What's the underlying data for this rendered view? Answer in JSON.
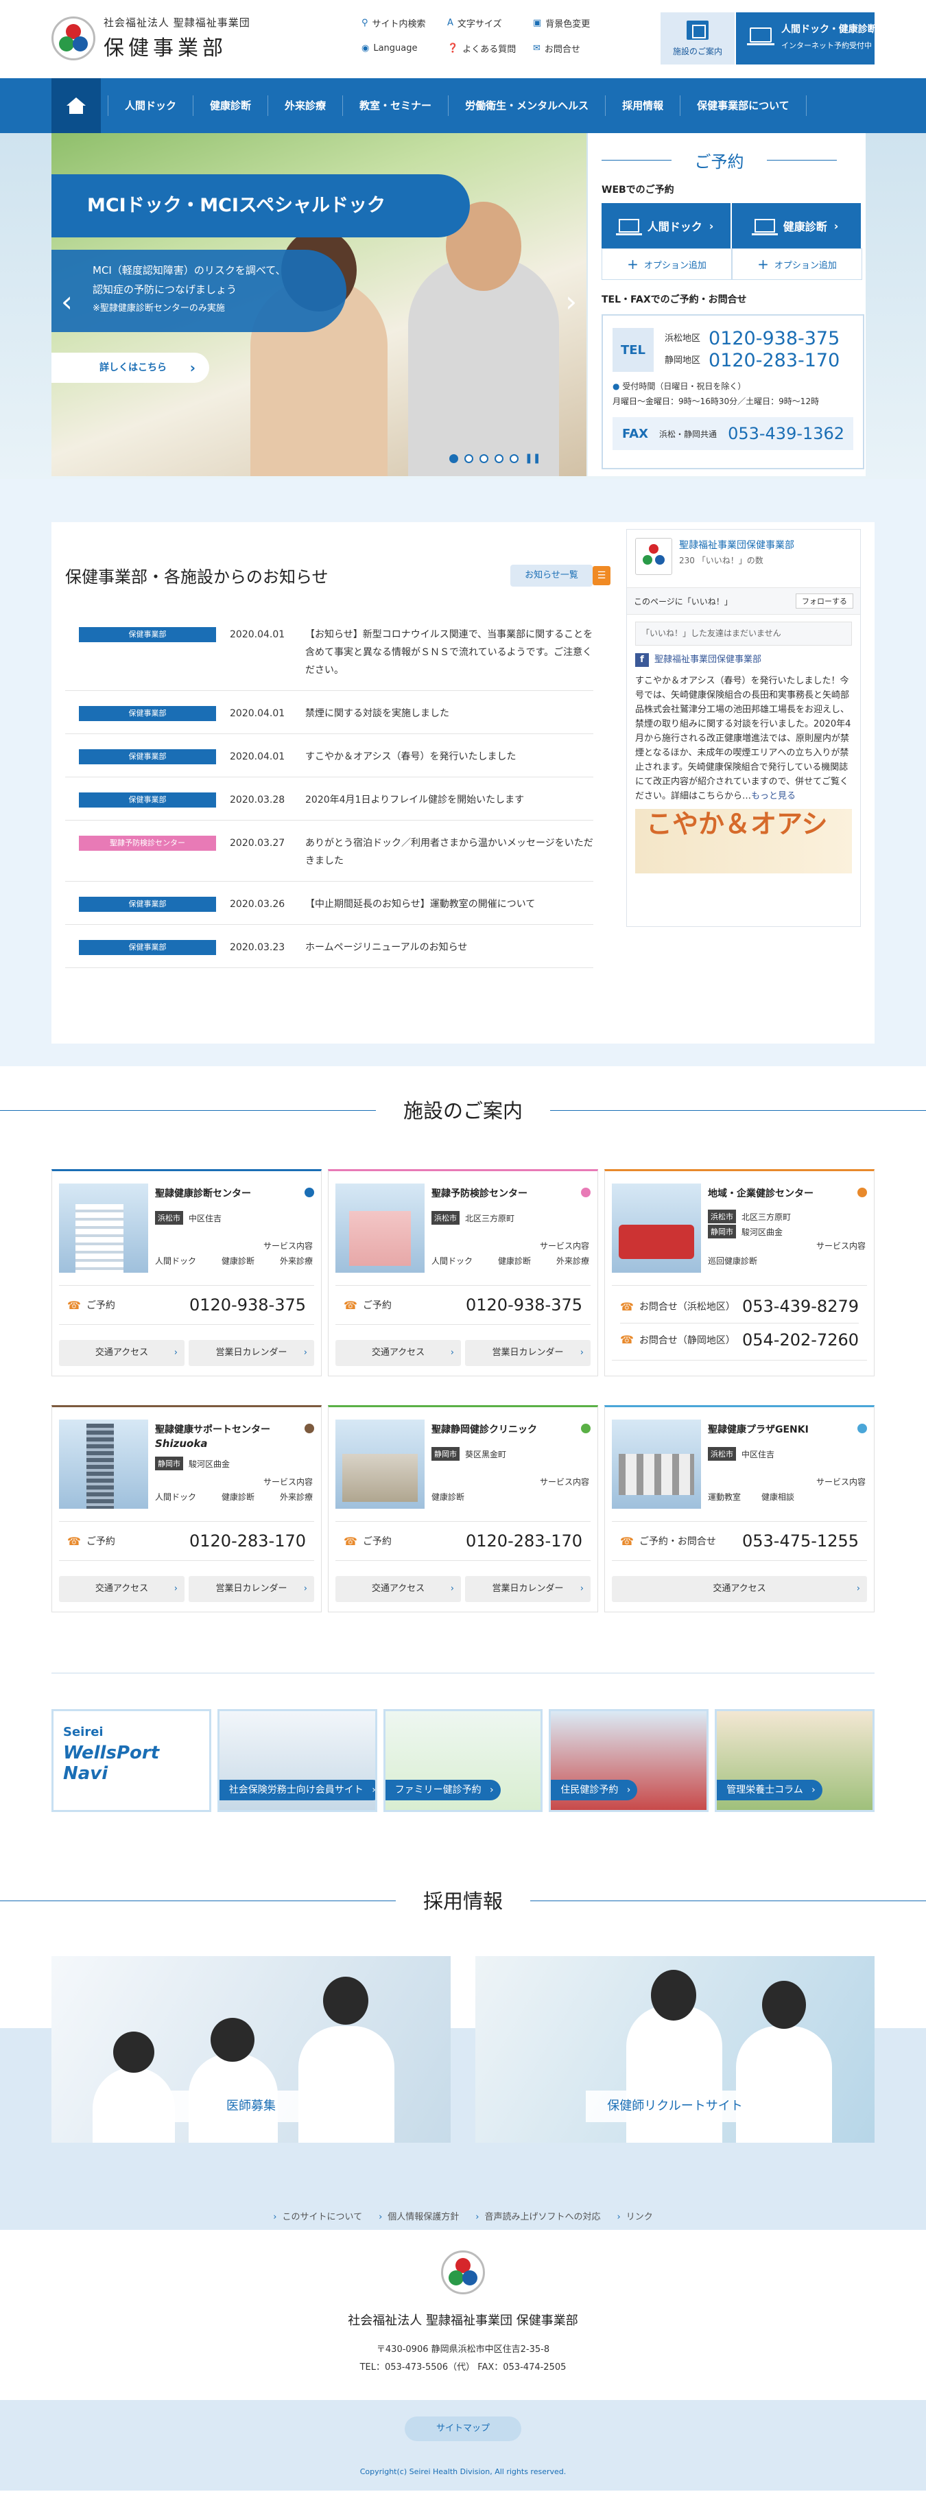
{
  "header": {
    "corp_name": "社会福祉法人 聖隷福祉事業団",
    "site_name": "保健事業部",
    "util": [
      "サイト内検索",
      "文字サイズ",
      "背景色変更",
      "Language",
      "よくある質問",
      "お問合せ"
    ],
    "facility_btn": "施設のご案内",
    "reserve_btn_title": "人間ドック・健康診断予約",
    "reserve_btn_sub": "インターネット予約受付中"
  },
  "nav": [
    "人間ドック",
    "健康診断",
    "外来診療",
    "教室・セミナー",
    "労働衛生・メンタルヘルス",
    "採用情報",
    "保健事業部について"
  ],
  "hero": {
    "title": "MCIドック・MCIスペシャルドック",
    "desc_line1": "MCI（軽度認知障害）のリスクを調べて、",
    "desc_line2": "認知症の予防につなげましょう",
    "desc_note": "※聖隷健康診断センターのみ実施",
    "more": "詳しくはこちら",
    "prev": "‹",
    "next": "›",
    "pause": "❚❚"
  },
  "reserve": {
    "title": "ご予約",
    "web_label": "WEBでのご予約",
    "dock_btn": "人間ドック",
    "checkup_btn": "健康診断",
    "option1": "オプション追加",
    "option2": "オプション追加",
    "tel_label": "TEL・FAXでのご予約・お問合せ",
    "tel": "TEL",
    "area1": "浜松地区",
    "area2": "静岡地区",
    "num1": "0120-938-375",
    "num2": "0120-283-170",
    "hours_title": "受付時間（日曜日・祝日を除く）",
    "hours": "月曜日～金曜日：9時～16時30分／土曜日：9時～12時",
    "fax": "FAX",
    "fax_area": "浜松・静岡共通",
    "fax_num": "053-439-1362"
  },
  "news": {
    "title": "保健事業部・各施設からのお知らせ",
    "list_btn": "お知らせ一覧",
    "rss": "☰",
    "items": [
      {
        "tag": "保健事業部",
        "date": "2020.04.01",
        "text": "【お知らせ】新型コロナウイルス関連で、当事業部に関することを含めて事実と異なる情報がＳＮＳで流れているようです。ご注意ください。"
      },
      {
        "tag": "保健事業部",
        "date": "2020.04.01",
        "text": "禁煙に関する対談を実施しました"
      },
      {
        "tag": "保健事業部",
        "date": "2020.04.01",
        "text": "すこやか＆オアシス（春号）を発行いたしました"
      },
      {
        "tag": "保健事業部",
        "date": "2020.03.28",
        "text": "2020年4月1日よりフレイル健診を開始いたします"
      },
      {
        "tag": "聖隷予防検診センター",
        "date": "2020.03.27",
        "text": "ありがとう宿泊ドック／利用者さまから温かいメッセージをいただきました"
      },
      {
        "tag": "保健事業部",
        "date": "2020.03.26",
        "text": "【中止期間延長のお知らせ】運動教室の開催について"
      },
      {
        "tag": "保健事業部",
        "date": "2020.03.23",
        "text": "ホームページリニューアルのお知らせ"
      }
    ]
  },
  "fb": {
    "page": "聖隷福祉事業団保健事業部",
    "likes": "230 「いいね！」の数",
    "like_btn": "このページに「いいね！」",
    "follow": "フォローする",
    "pre": "「いいね！」した友達はまだいません",
    "poster": "聖隷福祉事業団保健事業部",
    "text": "すこやか＆オアシス（春号）を発行いたしました！今号では、矢崎健康保険組合の長田和実事務長と矢崎部品株式会社鷲津分工場の池田邦雄工場長をお迎えし、禁煙の取り組みに関する対談を行いました。2020年4月から施行される改正健康増進法では、原則屋内が禁煙となるほか、未成年の喫煙エリアへの立ち入りが禁止されます。矢崎健康保険組合で発行している機関誌にて改正内容が紹介されていますので、併せてご覧ください。詳細はこちらから…",
    "more": "もっと見る",
    "img": "こやか＆オアシ"
  },
  "facilities": {
    "title": "施設のご案内",
    "service_label": "サービス内容",
    "access": "交通アクセス",
    "calendar": "営業日カレンダー",
    "items": [
      {
        "name": "聖隷健康診断センター",
        "city": "浜松市",
        "addr": "中区住吉",
        "svcs": [
          "人間ドック",
          "健康診断",
          "外来診療"
        ],
        "tel_label": "ご予約",
        "tel": "0120-938-375"
      },
      {
        "name": "聖隷予防検診センター",
        "city": "浜松市",
        "addr": "北区三方原町",
        "svcs": [
          "人間ドック",
          "健康診断",
          "外来診療"
        ],
        "tel_label": "ご予約",
        "tel": "0120-938-375"
      },
      {
        "name": "地域・企業健診センター",
        "city": "浜松市",
        "addr": "北区三方原町",
        "city2": "静岡市",
        "addr2": "駿河区曲金",
        "svcs": [
          "巡回健康診断"
        ],
        "tel_label": "お問合せ（浜松地区）",
        "tel": "053-439-8279",
        "tel_label2": "お問合せ（静岡地区）",
        "tel2": "054-202-7260"
      },
      {
        "name": "聖隷健康サポートセンター",
        "name_en": "Shizuoka",
        "city": "静岡市",
        "addr": "駿河区曲金",
        "svcs": [
          "人間ドック",
          "健康診断",
          "外来診療"
        ],
        "tel_label": "ご予約",
        "tel": "0120-283-170"
      },
      {
        "name": "聖隷静岡健診クリニック",
        "city": "静岡市",
        "addr": "葵区黒金町",
        "svcs": [
          "健康診断"
        ],
        "tel_label": "ご予約",
        "tel": "0120-283-170"
      },
      {
        "name": "聖隷健康プラザGENKI",
        "city": "浜松市",
        "addr": "中区住吉",
        "svcs": [
          "運動教室",
          "健康相談"
        ],
        "tel_label": "ご予約・お問合せ",
        "tel": "053-475-1255"
      }
    ]
  },
  "banners": [
    {
      "t1": "Seirei",
      "t2": "WellsPort Navi"
    },
    {
      "label": "社会保険労務士向け会員サイト"
    },
    {
      "label": "ファミリー健診予約"
    },
    {
      "label": "住民健診予約"
    },
    {
      "label": "管理栄養士コラム"
    }
  ],
  "recruit": {
    "title": "採用情報",
    "doctor": "医師募集",
    "nurse": "保健師リクルートサイト"
  },
  "footer": {
    "links": [
      "このサイトについて",
      "個人情報保護方針",
      "音声読み上げソフトへの対応",
      "リンク"
    ],
    "org": "社会福祉法人 聖隷福祉事業団 保健事業部",
    "address": "〒430-0906 静岡県浜松市中区住吉2-35-8",
    "telfax": "TEL：053-473-5506（代）  FAX：053-474-2505",
    "sitemap": "サイトマップ",
    "copyright": "Copyright(c) Seirei Health Division, All rights reserved."
  },
  "colors": {
    "primary": "#1a6eb5",
    "pink": "#e87ab6",
    "orange": "#e8892b"
  }
}
